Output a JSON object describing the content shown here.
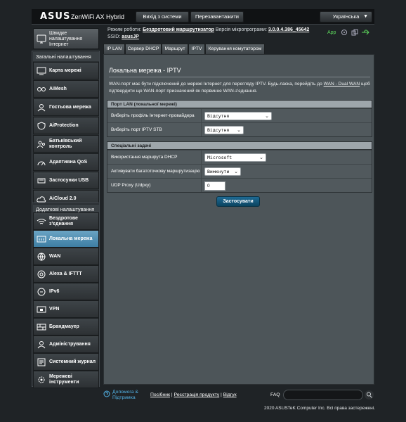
{
  "header": {
    "logo": "ASUS",
    "product": "ZenWiFi AX Hybrid",
    "logout_label": "Вихід з системи",
    "reboot_label": "Перезавантажити",
    "language": "Українська"
  },
  "status": {
    "mode_label": "Режим роботи:",
    "mode_value": "Бездротовий маршрутизатор",
    "fw_label": "Версія мікропрограми:",
    "fw_value": "3.0.0.4.386_45642",
    "ssid_label": "SSID:",
    "ssid_value": "asusJP",
    "app_label": "App"
  },
  "sidebar": {
    "quick_internet": "Швидке налаштування Інтернет",
    "general_title": "Загальні налаштування",
    "general_items": [
      "Карта мережі",
      "AiMesh",
      "Гостьова мережа",
      "AiProtection",
      "Батьківський контроль",
      "Адаптивна QoS",
      "Застосунки USB",
      "AiCloud 2.0"
    ],
    "advanced_title": "Додаткові налаштування",
    "advanced_items": [
      "Бездротове з'єднання",
      "Локальна мережа",
      "WAN",
      "Alexa & IFTTT",
      "IPv6",
      "VPN",
      "Брандмауер",
      "Адміністрування",
      "Системний журнал",
      "Мережеві інструменти"
    ]
  },
  "tabs": [
    "IP LAN",
    "Сервер DHCP",
    "Маршрут",
    "IPTV",
    "Керування комутатором"
  ],
  "main": {
    "title": "Локальна мережа - IPTV",
    "desc_part1": "WAN-порт має бути підключений до мережі Інтернет для перегляду IPTV. Будь-ласка, перейдіть до",
    "desc_link": "WAN - Dual WAN",
    "desc_part2": "щоб підтвердити що WAN-порт призначений як первинне WAN-з'єднання.",
    "lan_port": {
      "header": "Порт LAN (локальної мережі)",
      "isp_label": "Виберіть профіль Інтернет-провайдера",
      "isp_value": "Відсутня",
      "stb_label": "Виберіть порт IPTV STB",
      "stb_value": "Відсутня"
    },
    "special": {
      "header": "Спеціальні задачі",
      "dhcp_label": "Використання маршрута DHCP",
      "dhcp_value": "Microsoft",
      "multicast_label": "Активувати багатоточкову маршрутизацію",
      "multicast_value": "Вимкнути",
      "udpxy_label": "UDP Proxy (Udpxy)",
      "udpxy_value": "0"
    },
    "apply_label": "Застосувати"
  },
  "footer": {
    "help": "Допомога & Підтримка",
    "link1": "Посібник",
    "link2": "Реєстрація продукту",
    "link3": "Відгук",
    "faq": "FAQ",
    "copyright": "2020 ASUSTeK Computer Inc. Всі права застережені."
  }
}
